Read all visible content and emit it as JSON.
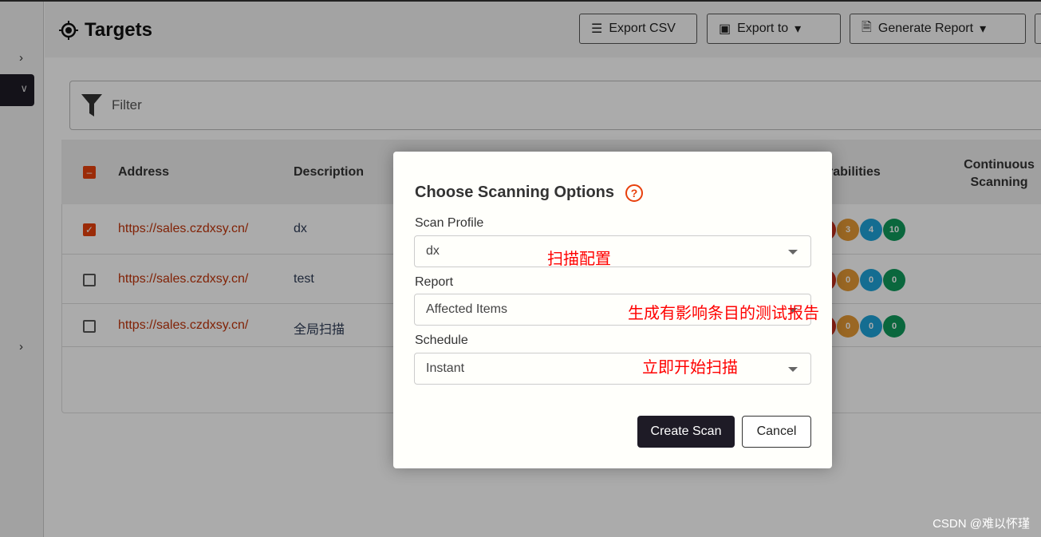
{
  "header": {
    "title": "Targets",
    "export_csv": "Export CSV",
    "export_to": "Export to",
    "generate_report": "Generate Report"
  },
  "filter": {
    "placeholder": "Filter"
  },
  "table": {
    "columns": [
      "Address",
      "Description",
      "Vulnerabilities",
      "Continuous Scanning"
    ],
    "rows": [
      {
        "address": "https://sales.czdxsy.cn/",
        "description": "dx",
        "checked": true,
        "vulns": [
          "",
          "3",
          "4",
          "10"
        ]
      },
      {
        "address": "https://sales.czdxsy.cn/",
        "description": "test",
        "checked": false,
        "vulns": [
          "",
          "0",
          "0",
          "0"
        ]
      },
      {
        "address": "https://sales.czdxsy.cn/",
        "description": "全局扫描",
        "checked": false,
        "vulns": [
          "",
          "0",
          "0",
          "0"
        ]
      }
    ]
  },
  "colors": {
    "accent": "#e8400c",
    "critical": "#d0301e",
    "high": "#e69a35",
    "medium": "#1ea3d8",
    "low": "#0f9a5c"
  },
  "modal": {
    "title": "Choose Scanning Options",
    "scan_profile_label": "Scan Profile",
    "scan_profile_value": "dx",
    "scan_profile_note": "扫描配置",
    "report_label": "Report",
    "report_value": "Affected Items",
    "report_note": "生成有影响条目的测试报告",
    "schedule_label": "Schedule",
    "schedule_value": "Instant",
    "schedule_note": "立即开始扫描",
    "create": "Create Scan",
    "cancel": "Cancel"
  },
  "watermark": "CSDN @难以怀瑾"
}
